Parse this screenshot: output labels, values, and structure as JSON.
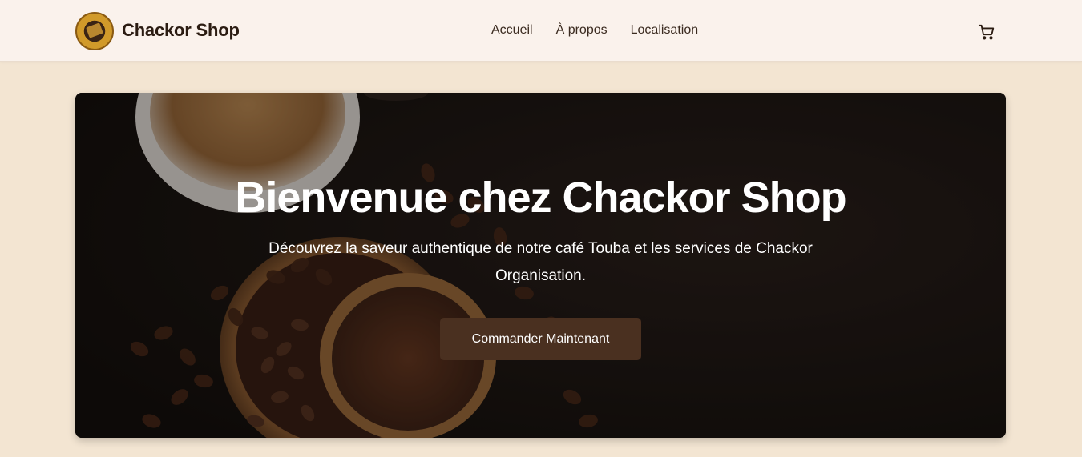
{
  "header": {
    "brand": "Chackor Shop",
    "logo_icon": "chackor-organisation-logo",
    "nav": [
      {
        "label": "Accueil"
      },
      {
        "label": "À propos"
      },
      {
        "label": "Localisation"
      }
    ],
    "cart_icon": "shopping-cart-icon"
  },
  "hero": {
    "title": "Bienvenue chez Chackor Shop",
    "subtitle": "Découvrez la saveur authentique de notre café Touba et les services de Chackor Organisation.",
    "cta_label": "Commander Maintenant",
    "background_image": "coffee-cups-beans-bowls"
  },
  "colors": {
    "page_bg": "#f3e5d2",
    "nav_bg": "#faf2ec",
    "brand_text": "#2b1c12",
    "cta_bg": "#4a3020"
  }
}
